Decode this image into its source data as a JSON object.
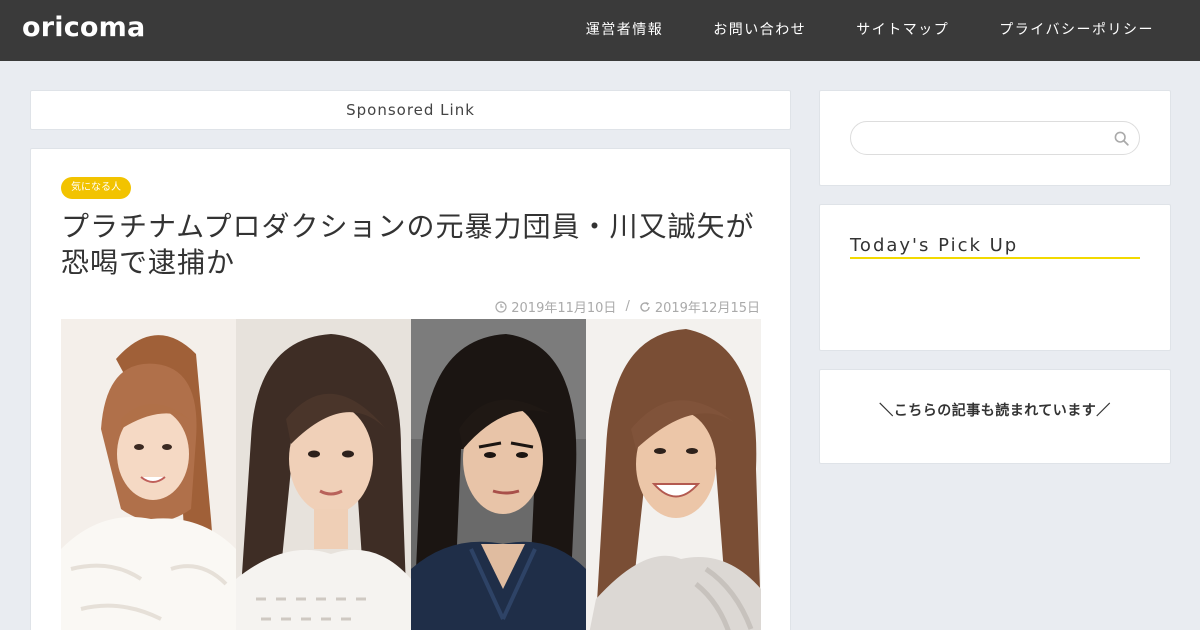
{
  "header": {
    "logo": "oricoma",
    "nav": [
      {
        "label": "運営者情報"
      },
      {
        "label": "お問い合わせ"
      },
      {
        "label": "サイトマップ"
      },
      {
        "label": "プライバシーポリシー"
      }
    ]
  },
  "sponsored": {
    "label": "Sponsored Link"
  },
  "article": {
    "category": "気になる人",
    "title": "プラチナムプロダクションの元暴力団員・川又誠矢が恐喝で逮捕か",
    "published": "2019年11月10日",
    "separator": "/",
    "updated": "2019年12月15日"
  },
  "sidebar": {
    "search": {
      "placeholder": ""
    },
    "pickup_title": "Today's Pick Up",
    "read_title": "＼こちらの記事も読まれています／"
  },
  "colors": {
    "header_bg": "#3a3a3a",
    "page_bg": "#e9ecf1",
    "accent_yellow": "#f2c300",
    "underline_yellow": "#f2d900"
  },
  "icons": {
    "published": "clock-icon",
    "updated": "refresh-icon",
    "search": "search-icon"
  }
}
